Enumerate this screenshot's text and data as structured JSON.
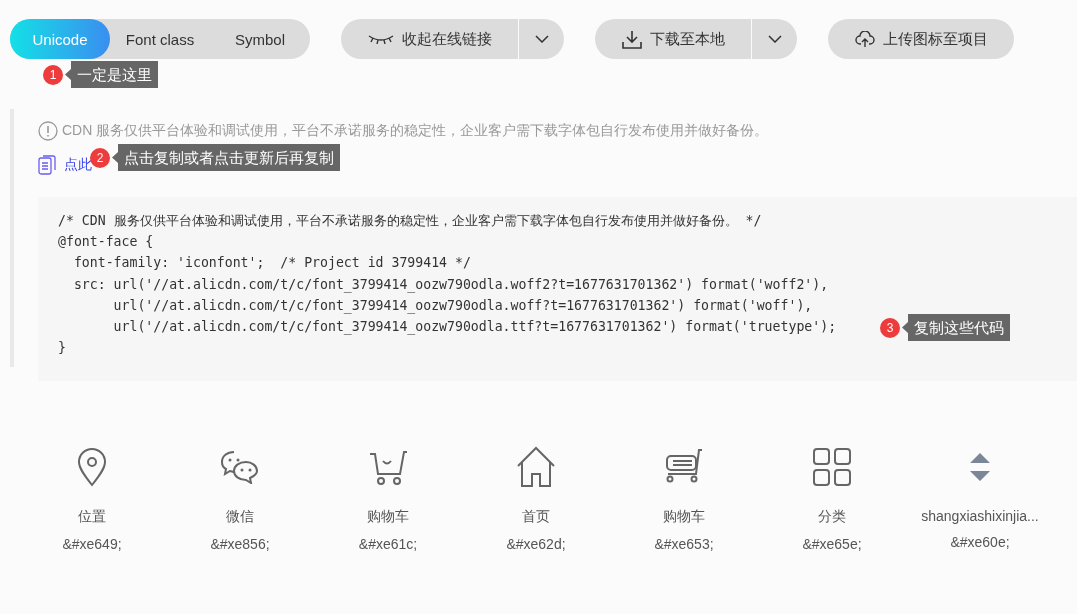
{
  "tabs": [
    {
      "label": "Unicode",
      "selected": true
    },
    {
      "label": "Font class",
      "selected": false
    },
    {
      "label": "Symbol",
      "selected": false
    }
  ],
  "toolbar": [
    {
      "kind": "eye",
      "label": "收起在线链接",
      "dropdown": true
    },
    {
      "kind": "download",
      "label": "下载至本地",
      "dropdown": true
    },
    {
      "kind": "upload",
      "label": "上传图标至项目",
      "dropdown": false
    }
  ],
  "notice": "CDN 服务仅供平台体验和调试使用，平台不承诺服务的稳定性，企业客户需下载字体包自行发布使用并做好备份。",
  "copy_link": "点此",
  "code_lines": [
    "/* CDN 服务仅供平台体验和调试使用，平台不承诺服务的稳定性，企业客户需下载字体包自行发布使用并做好备份。 */",
    "@font-face {",
    "  font-family: 'iconfont';  /* Project id 3799414 */",
    "  src: url('//at.alicdn.com/t/c/font_3799414_oozw790odla.woff2?t=1677631701362') format('woff2'),",
    "       url('//at.alicdn.com/t/c/font_3799414_oozw790odla.woff?t=1677631701362') format('woff'),",
    "       url('//at.alicdn.com/t/c/font_3799414_oozw790odla.ttf?t=1677631701362') format('truetype');",
    "}"
  ],
  "callouts": [
    {
      "number": "1",
      "text": "一定是这里"
    },
    {
      "number": "2",
      "text": "点击复制或者点击更新后再复制"
    },
    {
      "number": "3",
      "text": "复制这些代码"
    }
  ],
  "icons": [
    {
      "kind": "location",
      "name": "位置",
      "code": "&#xe649;"
    },
    {
      "kind": "chat",
      "name": "微信",
      "code": "&#xe856;"
    },
    {
      "kind": "cart",
      "name": "购物车",
      "code": "&#xe61c;"
    },
    {
      "kind": "home",
      "name": "首页",
      "code": "&#xe62d;"
    },
    {
      "kind": "trolley",
      "name": "购物车",
      "code": "&#xe653;"
    },
    {
      "kind": "grid",
      "name": "分类",
      "code": "&#xe65e;"
    },
    {
      "kind": "updown",
      "name": "shangxiashixinjia...",
      "code": "&#xe60e;"
    }
  ]
}
